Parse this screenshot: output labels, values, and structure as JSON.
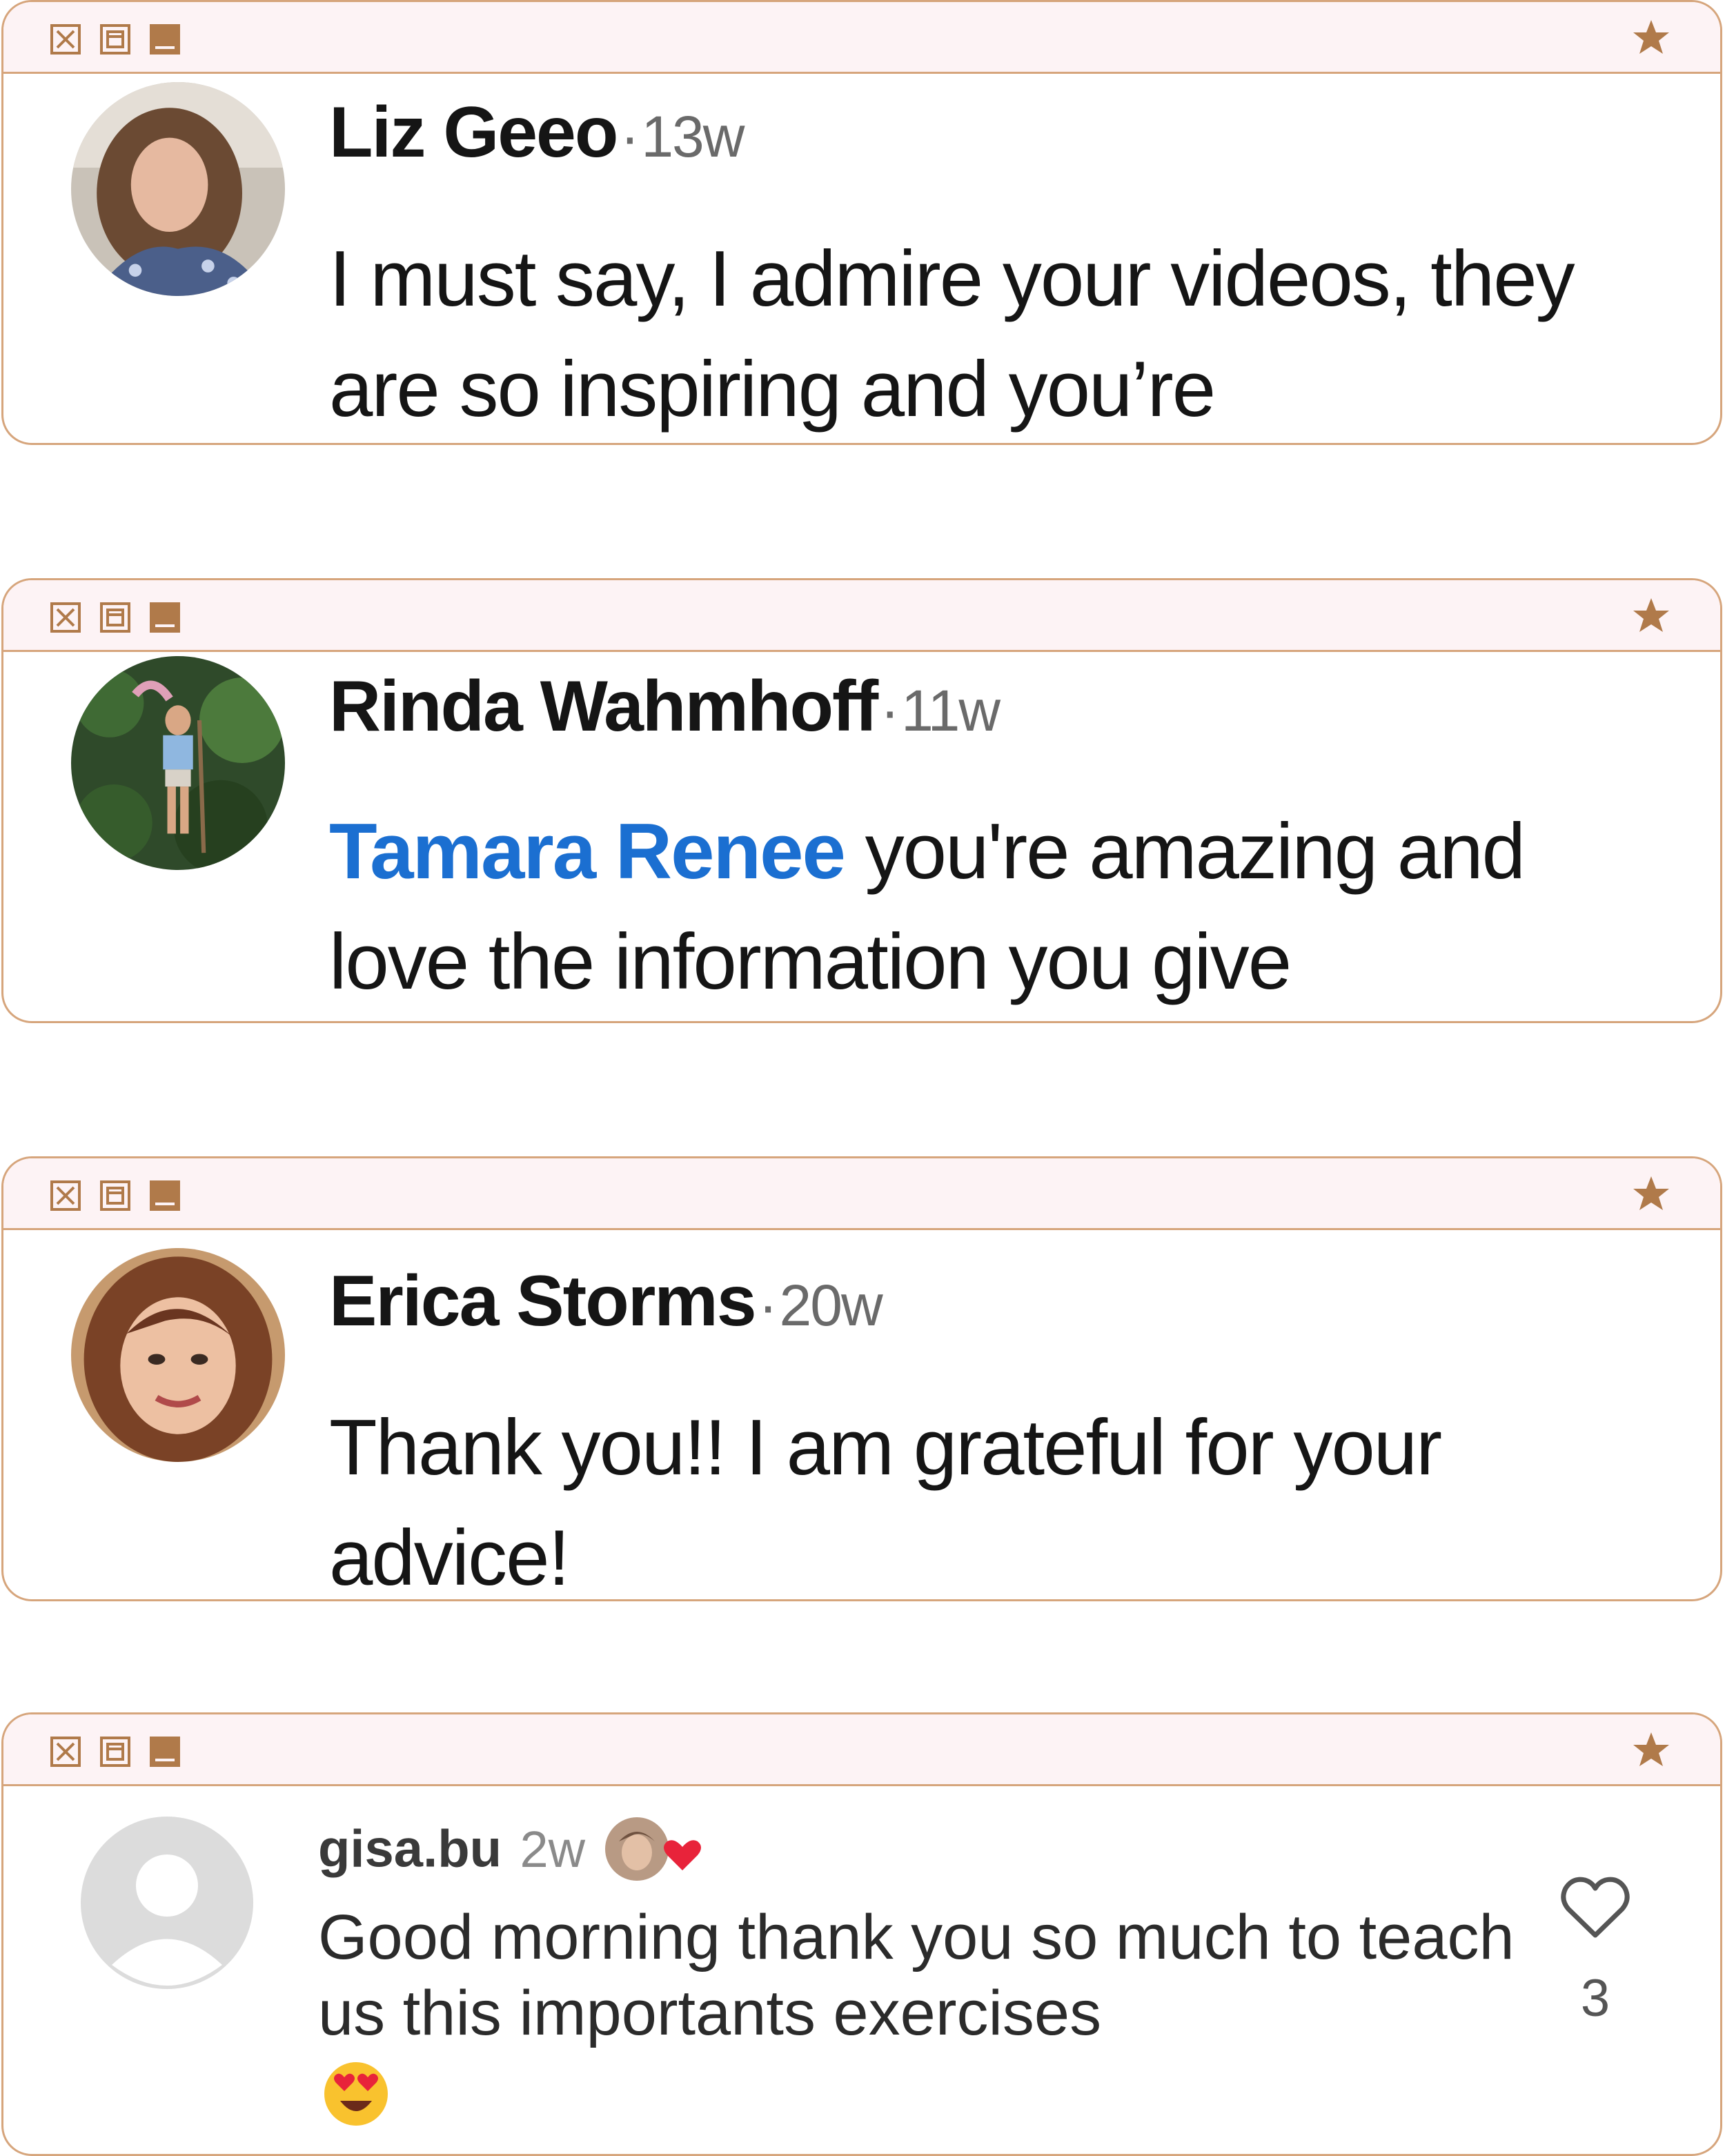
{
  "window_controls": {
    "close_icon": "close-square-icon",
    "maximize_icon": "restore-square-icon",
    "minimize_icon": "minimize-square-icon",
    "favorite_icon": "star-icon"
  },
  "accent_colors": {
    "border": "#d6a57c",
    "titlebar_bg": "#fdf3f5",
    "mention": "#1b6fd1",
    "heart": "#e8233a"
  },
  "comments": [
    {
      "author": "Liz Geeo",
      "separator": "·",
      "time": "13w",
      "text": "I must say, I admire your videos, they are so inspiring and you’re"
    },
    {
      "author": "Rinda Wahmhoff",
      "separator": "·",
      "time": "11w",
      "mention": "Tamara Renee",
      "text": " you're amazing and love the information you give"
    },
    {
      "author": "Erica Storms",
      "separator": "·",
      "time": "20w",
      "text": "Thank you!! I am grateful for your advice!"
    },
    {
      "author": "gisa.bu",
      "time": "2w",
      "text": "Good morning thank you so much to teach us this  importants exercises",
      "emoji": "heart-eyes-emoji",
      "like_count": "3"
    }
  ]
}
